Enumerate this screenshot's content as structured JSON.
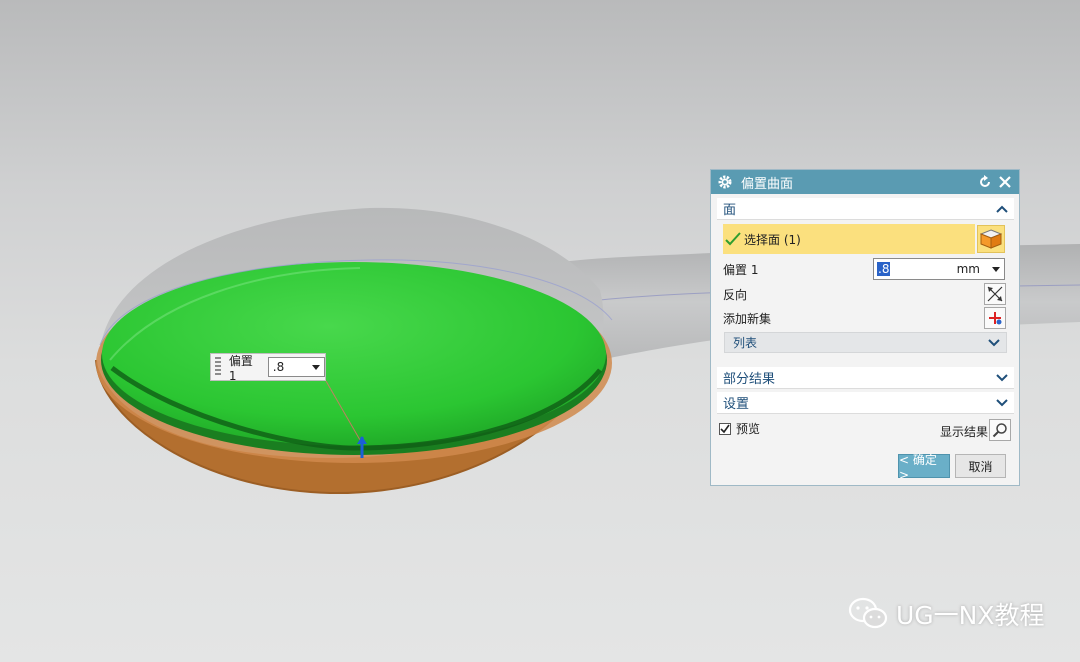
{
  "viewport": {
    "model": "spoon-offset-surface",
    "colors": {
      "face": "#2ecb36",
      "bowl_underside": "#b46f2e",
      "body": "#c4c5c6"
    }
  },
  "onscreen_input": {
    "label": "偏置 1",
    "value": ".8"
  },
  "dialog": {
    "title": "偏置曲面",
    "sections": {
      "face": {
        "header": "面",
        "select_label": "选择面 (1)",
        "offset_label": "偏置 1",
        "offset_value": ".8",
        "offset_unit": "mm",
        "reverse_label": "反向",
        "add_set_label": "添加新集",
        "list_label": "列表"
      },
      "partial_results": {
        "header": "部分结果"
      },
      "settings": {
        "header": "设置"
      }
    },
    "preview_label": "预览",
    "preview_checked": true,
    "show_result_label": "显示结果",
    "ok_label": "< 确定 >",
    "cancel_label": "取消"
  },
  "watermark": {
    "text": "UG一NX教程"
  }
}
